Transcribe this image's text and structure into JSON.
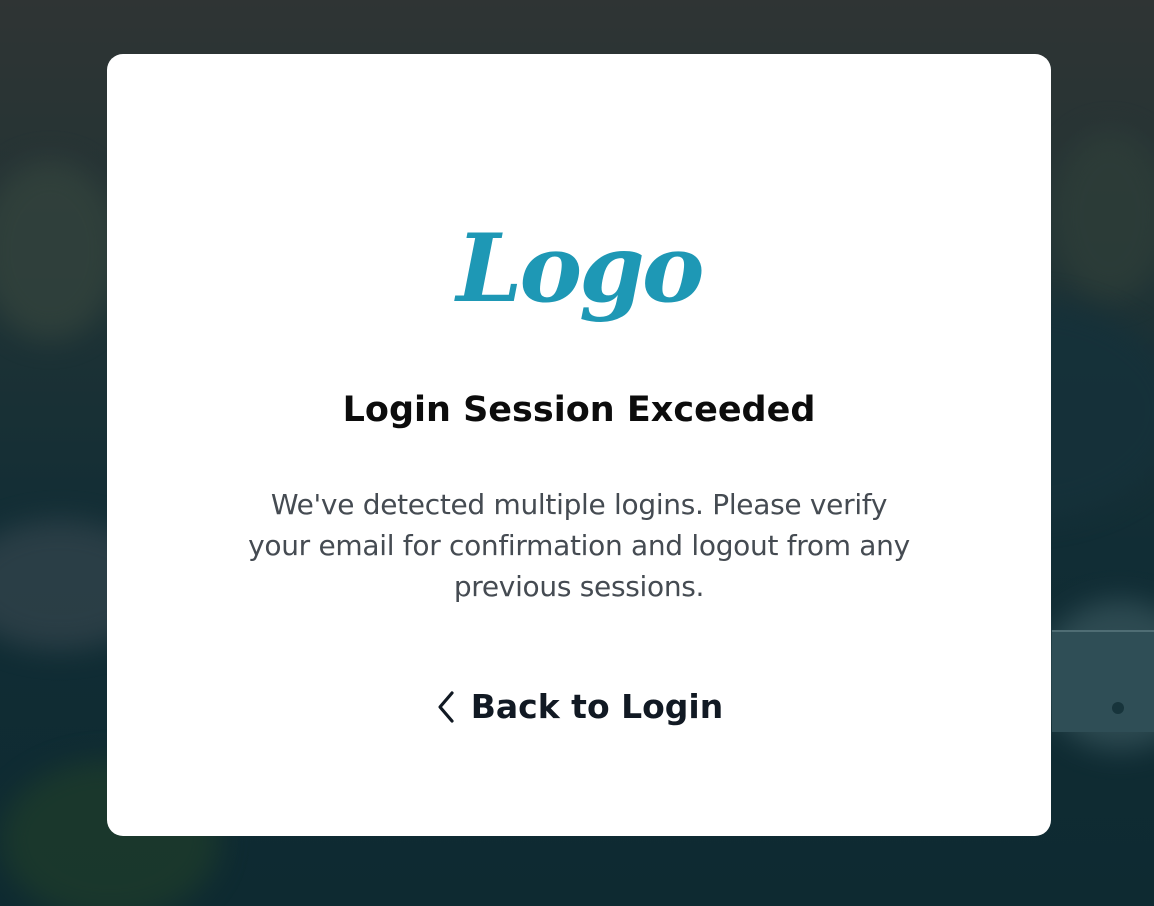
{
  "logo": {
    "text": "Logo",
    "color": "#1e98b5"
  },
  "modal": {
    "title": "Login Session Exceeded",
    "message": "We've detected multiple logins. Please verify your email for confirmation and logout from any previous sessions.",
    "back_link": {
      "label": "Back to Login",
      "icon": "chevron-left-icon"
    }
  }
}
